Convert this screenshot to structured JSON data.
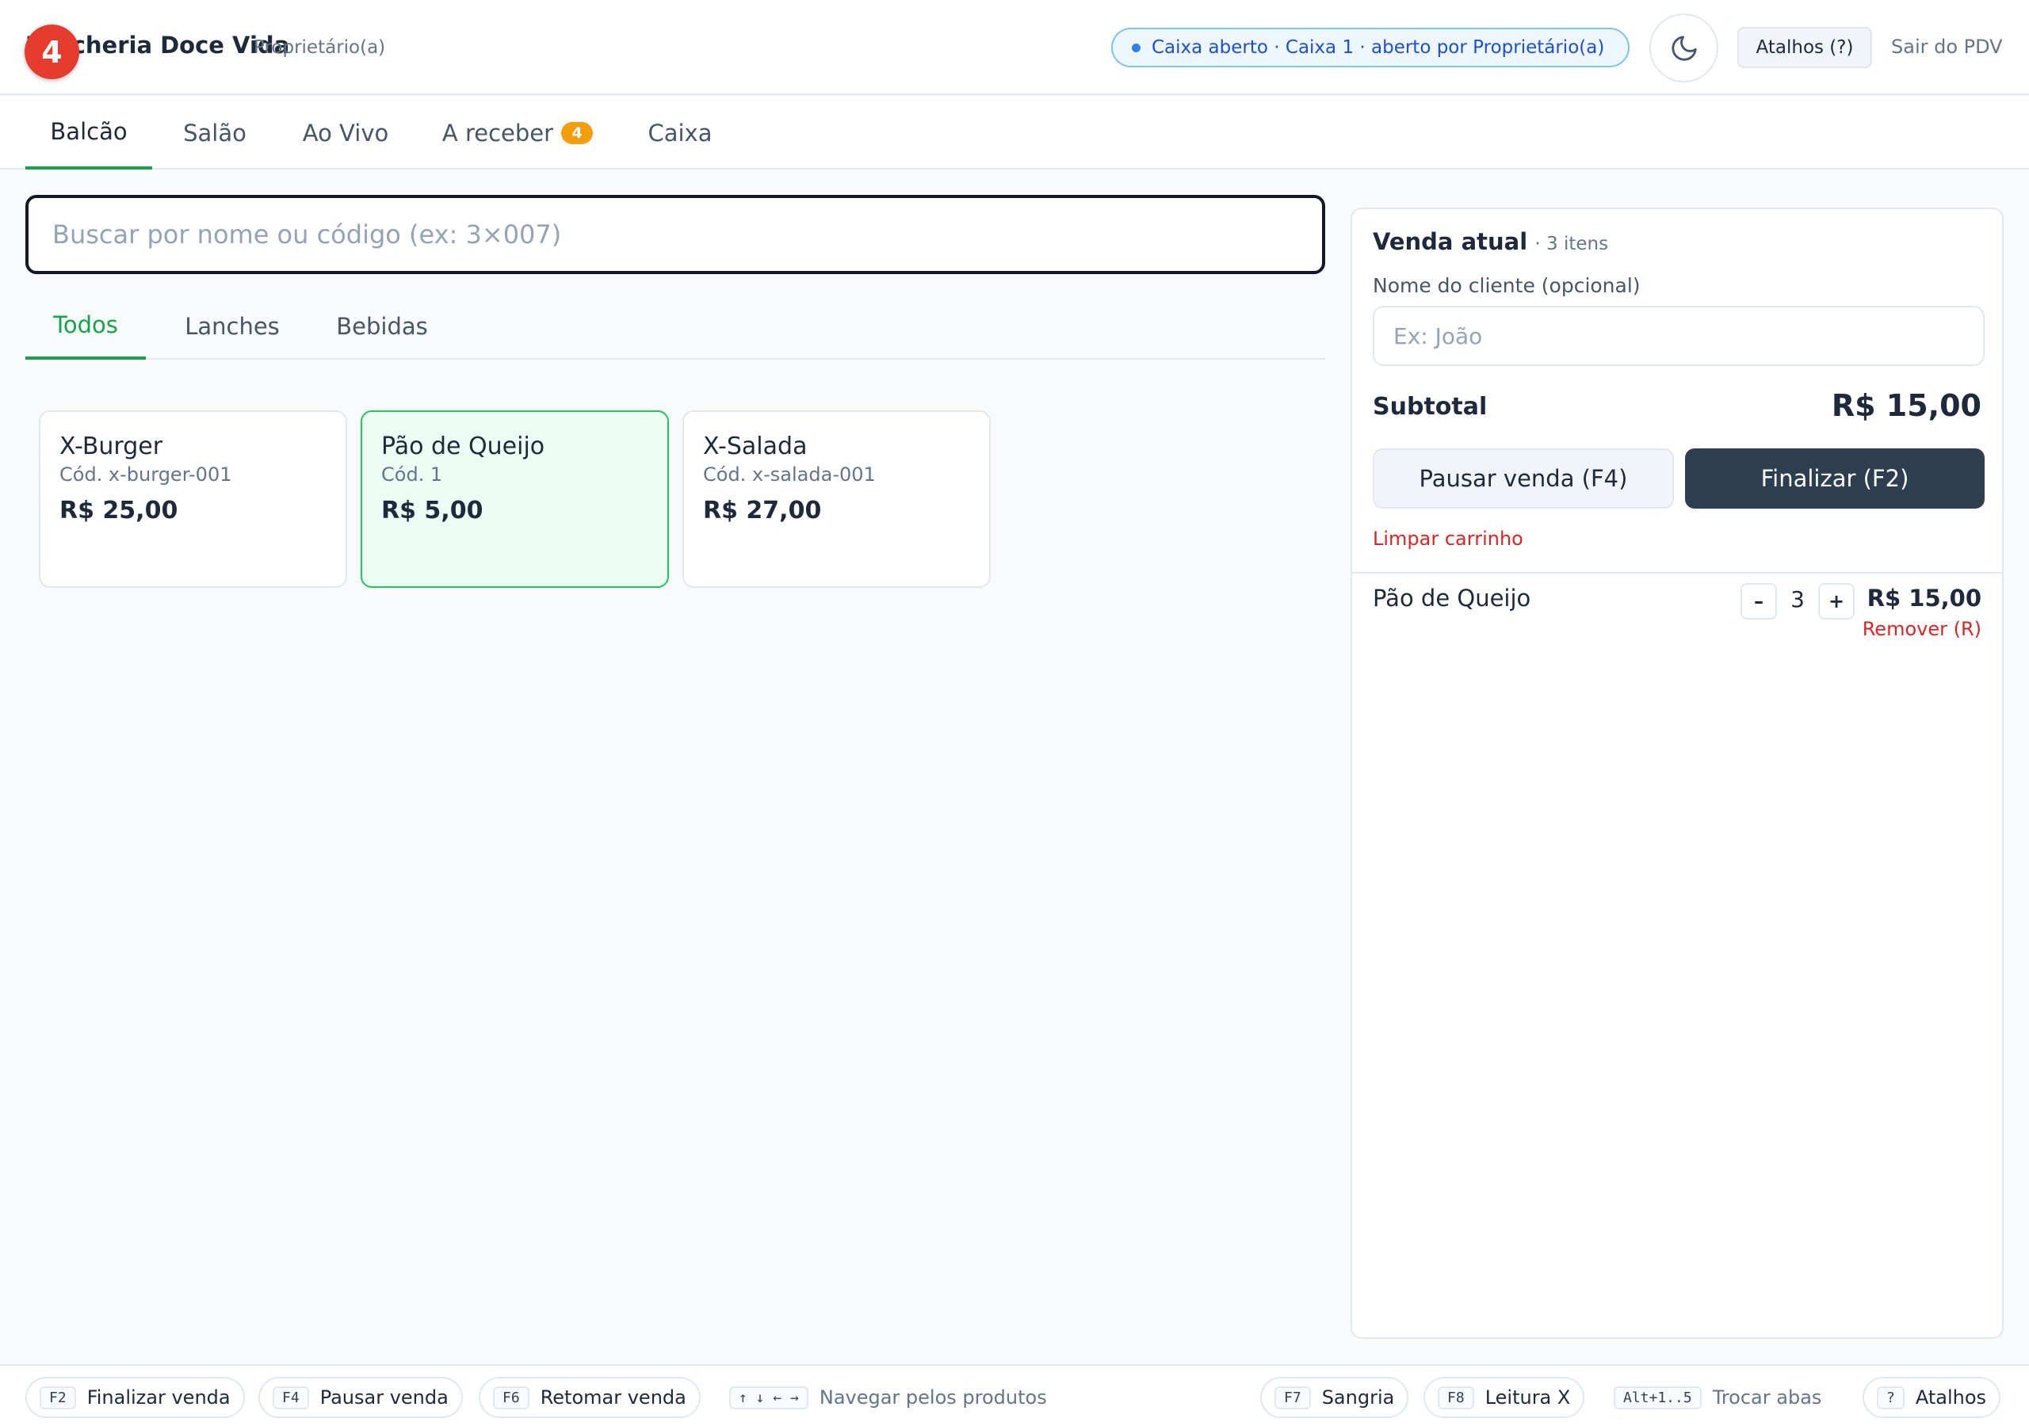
{
  "header": {
    "badge": "4",
    "brand": "Lancheria Doce Vida",
    "role": "Proprietário(a)",
    "status": "Caixa aberto · Caixa 1 · aberto por Proprietário(a)",
    "shortcuts_label": "Atalhos (?)",
    "exit_label": "Sair do PDV",
    "theme_icon": "moon-icon"
  },
  "tabs": [
    {
      "label": "Balcão",
      "active": true
    },
    {
      "label": "Salão"
    },
    {
      "label": "Ao Vivo"
    },
    {
      "label": "A receber",
      "count": "4"
    },
    {
      "label": "Caixa"
    }
  ],
  "search": {
    "placeholder": "Buscar por nome ou código (ex: 3×007)",
    "value": ""
  },
  "categories": [
    {
      "label": "Todos",
      "active": true
    },
    {
      "label": "Lanches"
    },
    {
      "label": "Bebidas"
    }
  ],
  "products": [
    {
      "name": "X-Burger",
      "code": "Cód. x-burger-001",
      "price": "R$ 25,00"
    },
    {
      "name": "Pão de Queijo",
      "code": "Cód. 1",
      "price": "R$ 5,00",
      "selected": true
    },
    {
      "name": "X-Salada",
      "code": "Cód. x-salada-001",
      "price": "R$ 27,00"
    }
  ],
  "cart": {
    "title": "Venda atual",
    "count_label": "· 3 itens",
    "client_label": "Nome do cliente (opcional)",
    "client_placeholder": "Ex: João",
    "subtotal_label": "Subtotal",
    "subtotal_value": "R$ 15,00",
    "pause_label": "Pausar venda (F4)",
    "finish_label": "Finalizar (F2)",
    "clear_label": "Limpar carrinho",
    "items": [
      {
        "name": "Pão de Queijo",
        "qty": "3",
        "price": "R$ 15,00",
        "remove": "Remover (R)",
        "minus": "–",
        "plus": "+"
      }
    ]
  },
  "footer": [
    {
      "key": "F2",
      "label": "Finalizar venda"
    },
    {
      "key": "F4",
      "label": "Pausar venda"
    },
    {
      "key": "F6",
      "label": "Retomar venda"
    },
    {
      "key": "↑ ↓ ← →",
      "label": "Navegar pelos produtos"
    },
    {
      "key": "F7",
      "label": "Sangria"
    },
    {
      "key": "F8",
      "label": "Leitura X"
    },
    {
      "key": "Alt+1..5",
      "label": "Trocar abas"
    },
    {
      "key": "?",
      "label": "Atalhos"
    }
  ],
  "colors": {
    "accent": "#16a34a",
    "dark_button": "#2c3e50",
    "danger": "#dc2626",
    "badge": "#e63b2e",
    "count_badge": "#f59e0b",
    "status_blue": "#1d4ed8"
  }
}
